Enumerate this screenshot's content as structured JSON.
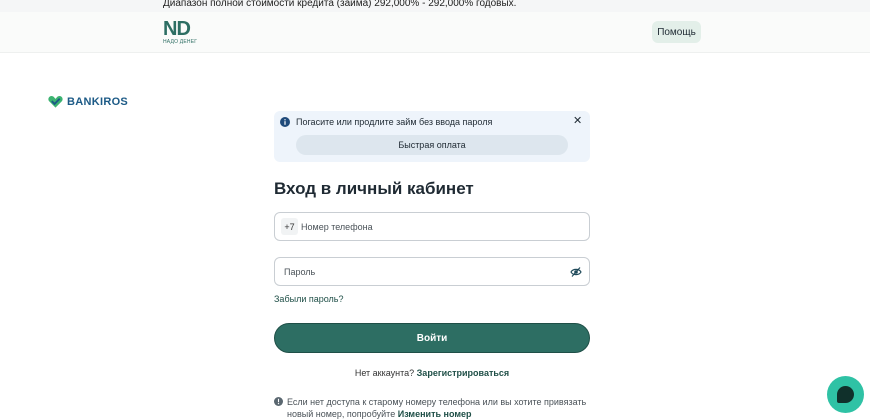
{
  "topline": {
    "text": "Диапазон полной стоимости кредита (займа) 292,000% - 292,000% годовых."
  },
  "header": {
    "logo_mark": "ND",
    "logo_sub": "НАДО ДЕНЕГ",
    "help_label": "Помощь"
  },
  "partner": {
    "name": "BANKIROS",
    "icon": "heart-check-icon"
  },
  "notice": {
    "text": "Погасите или продлите займ без ввода пароля",
    "quick_pay_label": "Быстрая оплата",
    "close_glyph": "✕"
  },
  "form": {
    "title": "Вход в личный кабинет",
    "phone_prefix": "+7",
    "phone_placeholder": "Номер телефона",
    "password_placeholder": "Пароль",
    "forgot_label": "Забыли пароль?",
    "login_label": "Войти",
    "no_account_text": "Нет аккаунта?",
    "register_label": "Зарегистрироваться",
    "hint_line1": "Если нет доступа к старому номеру телефона или вы хотите привязать",
    "hint_line2_prefix": "новый номер, попробуйте",
    "change_number_label": "Изменить номер"
  },
  "colors": {
    "brand": "#2d6e63",
    "chat": "#2fc2a5",
    "notice_bg": "#eef4fb"
  }
}
